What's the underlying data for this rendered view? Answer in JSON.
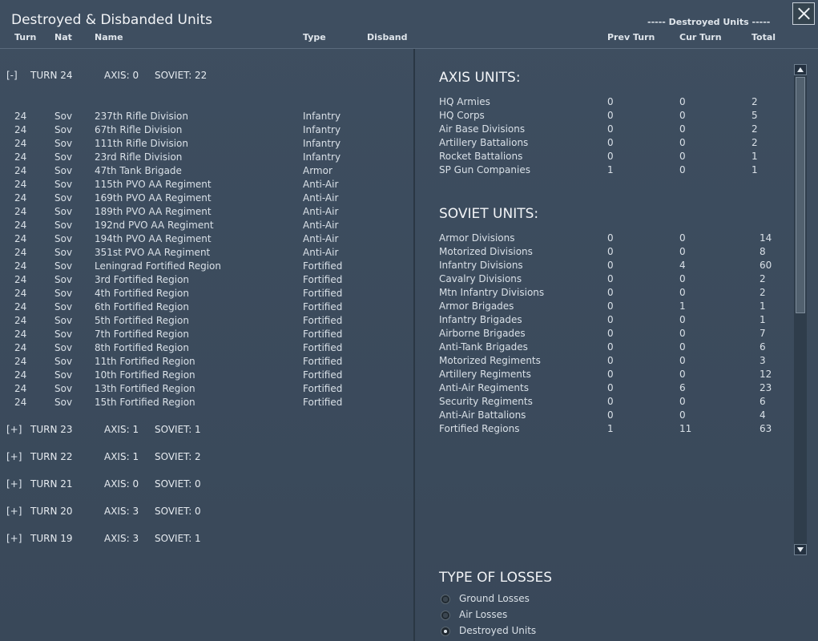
{
  "window": {
    "title": "Destroyed & Disbanded Units",
    "destroyed_units_header": "----- Destroyed Units -----"
  },
  "columns": {
    "turn": "Turn",
    "nat": "Nat",
    "name": "Name",
    "type": "Type",
    "disband": "Disband",
    "prev_turn": "Prev Turn",
    "cur_turn": "Cur Turn",
    "total": "Total"
  },
  "turns": [
    {
      "toggle": "[-]",
      "label": "TURN 24",
      "axis": "AXIS: 0",
      "soviet": "SOVIET: 22"
    },
    {
      "toggle": "[+]",
      "label": "TURN 23",
      "axis": "AXIS: 1",
      "soviet": "SOVIET: 1"
    },
    {
      "toggle": "[+]",
      "label": "TURN 22",
      "axis": "AXIS: 1",
      "soviet": "SOVIET: 2"
    },
    {
      "toggle": "[+]",
      "label": "TURN 21",
      "axis": "AXIS: 0",
      "soviet": "SOVIET: 0"
    },
    {
      "toggle": "[+]",
      "label": "TURN 20",
      "axis": "AXIS: 3",
      "soviet": "SOVIET: 0"
    },
    {
      "toggle": "[+]",
      "label": "TURN 19",
      "axis": "AXIS: 3",
      "soviet": "SOVIET: 1"
    }
  ],
  "units": [
    {
      "turn": "24",
      "nat": "Sov",
      "name": "237th Rifle Division",
      "type": "Infantry"
    },
    {
      "turn": "24",
      "nat": "Sov",
      "name": "67th Rifle Division",
      "type": "Infantry"
    },
    {
      "turn": "24",
      "nat": "Sov",
      "name": "111th Rifle Division",
      "type": "Infantry"
    },
    {
      "turn": "24",
      "nat": "Sov",
      "name": "23rd Rifle Division",
      "type": "Infantry"
    },
    {
      "turn": "24",
      "nat": "Sov",
      "name": "47th Tank Brigade",
      "type": "Armor"
    },
    {
      "turn": "24",
      "nat": "Sov",
      "name": "115th PVO AA Regiment",
      "type": "Anti-Air"
    },
    {
      "turn": "24",
      "nat": "Sov",
      "name": "169th PVO AA Regiment",
      "type": "Anti-Air"
    },
    {
      "turn": "24",
      "nat": "Sov",
      "name": "189th PVO AA Regiment",
      "type": "Anti-Air"
    },
    {
      "turn": "24",
      "nat": "Sov",
      "name": "192nd PVO AA Regiment",
      "type": "Anti-Air"
    },
    {
      "turn": "24",
      "nat": "Sov",
      "name": "194th PVO AA Regiment",
      "type": "Anti-Air"
    },
    {
      "turn": "24",
      "nat": "Sov",
      "name": "351st PVO AA Regiment",
      "type": "Anti-Air"
    },
    {
      "turn": "24",
      "nat": "Sov",
      "name": "Leningrad Fortified Region",
      "type": "Fortified"
    },
    {
      "turn": "24",
      "nat": "Sov",
      "name": "3rd Fortified Region",
      "type": "Fortified"
    },
    {
      "turn": "24",
      "nat": "Sov",
      "name": "4th Fortified Region",
      "type": "Fortified"
    },
    {
      "turn": "24",
      "nat": "Sov",
      "name": "6th Fortified Region",
      "type": "Fortified"
    },
    {
      "turn": "24",
      "nat": "Sov",
      "name": "5th Fortified Region",
      "type": "Fortified"
    },
    {
      "turn": "24",
      "nat": "Sov",
      "name": "7th Fortified Region",
      "type": "Fortified"
    },
    {
      "turn": "24",
      "nat": "Sov",
      "name": "8th Fortified Region",
      "type": "Fortified"
    },
    {
      "turn": "24",
      "nat": "Sov",
      "name": "11th Fortified Region",
      "type": "Fortified"
    },
    {
      "turn": "24",
      "nat": "Sov",
      "name": "10th Fortified Region",
      "type": "Fortified"
    },
    {
      "turn": "24",
      "nat": "Sov",
      "name": "13th Fortified Region",
      "type": "Fortified"
    },
    {
      "turn": "24",
      "nat": "Sov",
      "name": "15th Fortified Region",
      "type": "Fortified"
    }
  ],
  "axis": {
    "title": "AXIS UNITS:",
    "rows": [
      {
        "name": "HQ Armies",
        "prev": "0",
        "cur": "0",
        "total": "2"
      },
      {
        "name": "HQ Corps",
        "prev": "0",
        "cur": "0",
        "total": "5"
      },
      {
        "name": "Air Base Divisions",
        "prev": "0",
        "cur": "0",
        "total": "2"
      },
      {
        "name": "Artillery Battalions",
        "prev": "0",
        "cur": "0",
        "total": "2"
      },
      {
        "name": "Rocket Battalions",
        "prev": "0",
        "cur": "0",
        "total": "1"
      },
      {
        "name": "SP Gun Companies",
        "prev": "1",
        "cur": "0",
        "total": "1"
      }
    ]
  },
  "soviet": {
    "title": "SOVIET UNITS:",
    "rows": [
      {
        "name": "Armor Divisions",
        "prev": "0",
        "cur": "0",
        "total": "14"
      },
      {
        "name": "Motorized Divisions",
        "prev": "0",
        "cur": "0",
        "total": "8"
      },
      {
        "name": "Infantry Divisions",
        "prev": "0",
        "cur": "4",
        "total": "60"
      },
      {
        "name": "Cavalry Divisions",
        "prev": "0",
        "cur": "0",
        "total": "2"
      },
      {
        "name": "Mtn Infantry Divisions",
        "prev": "0",
        "cur": "0",
        "total": "2"
      },
      {
        "name": "Armor Brigades",
        "prev": "0",
        "cur": "1",
        "total": "1"
      },
      {
        "name": "Infantry Brigades",
        "prev": "0",
        "cur": "0",
        "total": "1"
      },
      {
        "name": "Airborne Brigades",
        "prev": "0",
        "cur": "0",
        "total": "7"
      },
      {
        "name": "Anti-Tank Brigades",
        "prev": "0",
        "cur": "0",
        "total": "6"
      },
      {
        "name": "Motorized Regiments",
        "prev": "0",
        "cur": "0",
        "total": "3"
      },
      {
        "name": "Artillery Regiments",
        "prev": "0",
        "cur": "0",
        "total": "12"
      },
      {
        "name": "Anti-Air Regiments",
        "prev": "0",
        "cur": "6",
        "total": "23"
      },
      {
        "name": "Security Regiments",
        "prev": "0",
        "cur": "0",
        "total": "6"
      },
      {
        "name": "Anti-Air Battalions",
        "prev": "0",
        "cur": "0",
        "total": "4"
      },
      {
        "name": "Fortified Regions",
        "prev": "1",
        "cur": "11",
        "total": "63"
      }
    ]
  },
  "losses": {
    "title": "TYPE OF LOSSES",
    "options": [
      {
        "label": "Ground Losses",
        "checked": false
      },
      {
        "label": "Air Losses",
        "checked": false
      },
      {
        "label": "Destroyed Units",
        "checked": true
      }
    ]
  }
}
